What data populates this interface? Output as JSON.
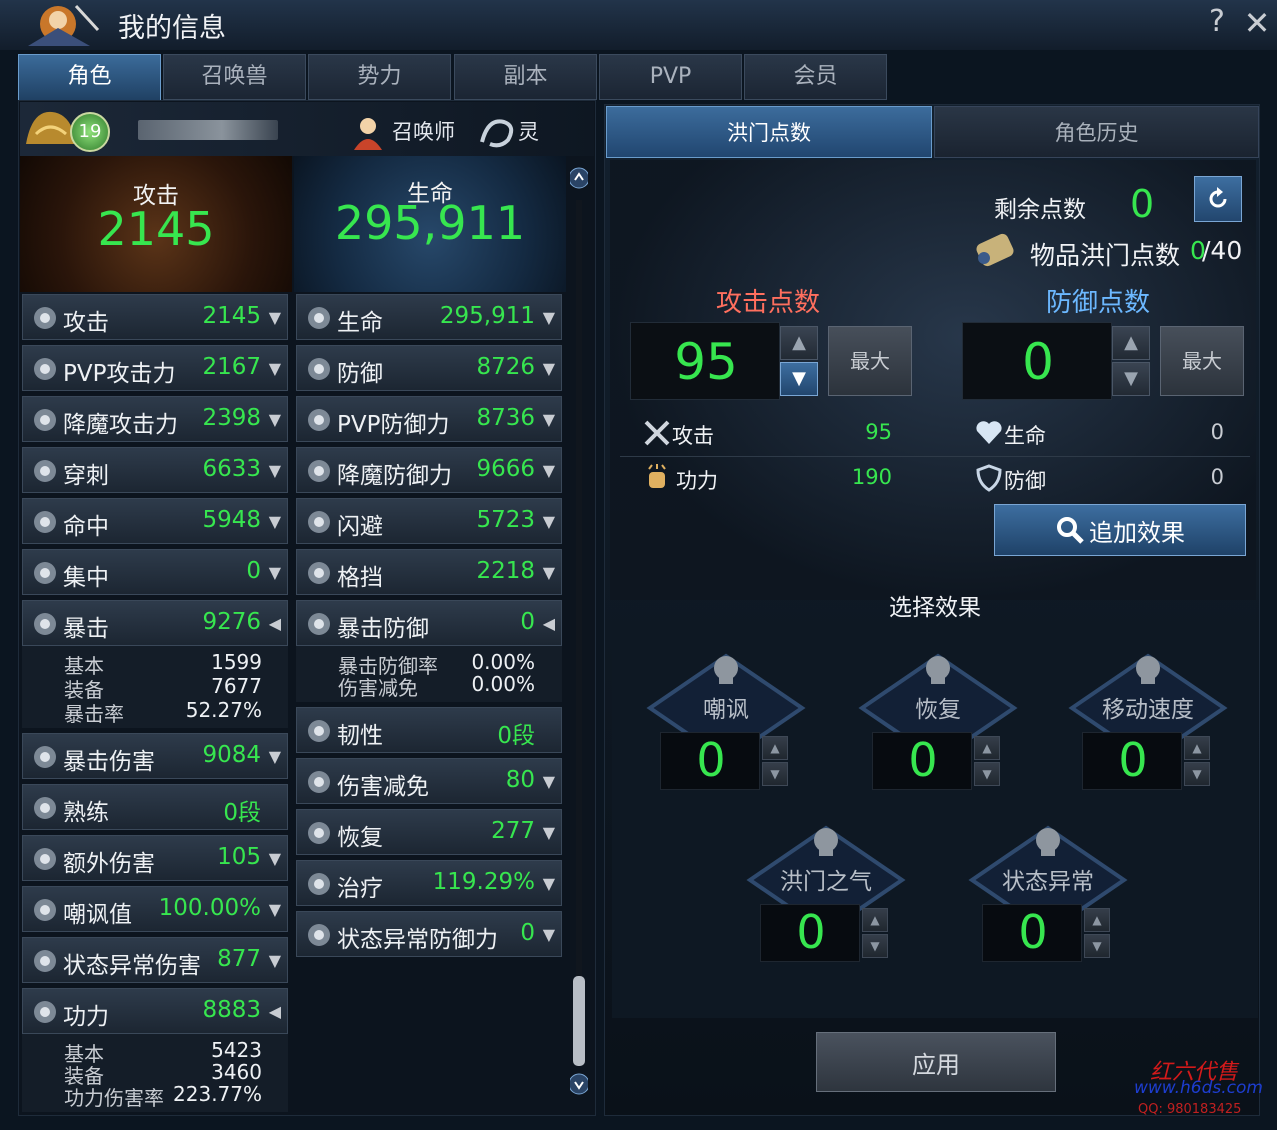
{
  "window": {
    "title": "我的信息",
    "help_label": "?",
    "close_label": "✕"
  },
  "tabs": [
    {
      "label": "角色",
      "active": true
    },
    {
      "label": "召唤兽",
      "active": false
    },
    {
      "label": "势力",
      "active": false
    },
    {
      "label": "副本",
      "active": false
    },
    {
      "label": "PVP",
      "active": false
    },
    {
      "label": "会员",
      "active": false
    }
  ],
  "character": {
    "level": "19",
    "summoner_label": "召唤师",
    "spirit_label": "灵"
  },
  "hero": {
    "attack_label": "攻击",
    "attack_value": "2145",
    "hp_label": "生命",
    "hp_value": "295,911"
  },
  "left_stats": [
    {
      "name": "攻击",
      "value": "2145",
      "icon": "sword-icon"
    },
    {
      "name": "PVP攻击力",
      "value": "2167",
      "icon": "pvp-attack-icon"
    },
    {
      "name": "降魔攻击力",
      "value": "2398",
      "icon": "demon-attack-icon"
    },
    {
      "name": "穿刺",
      "value": "6633",
      "icon": "pierce-icon"
    },
    {
      "name": "命中",
      "value": "5948",
      "icon": "crosshair-icon"
    },
    {
      "name": "集中",
      "value": "0",
      "icon": "focus-icon"
    },
    {
      "name": "暴击",
      "value": "9276",
      "icon": "critical-icon"
    },
    {
      "name": "暴击伤害",
      "value": "9084",
      "icon": "critical-damage-icon"
    },
    {
      "name": "熟练",
      "value": "0段",
      "icon": "mastery-icon"
    },
    {
      "name": "额外伤害",
      "value": "105",
      "icon": "extra-damage-icon"
    },
    {
      "name": "嘲讽值",
      "value": "100.00%",
      "icon": "taunt-icon"
    },
    {
      "name": "状态异常伤害",
      "value": "877",
      "icon": "status-damage-icon"
    },
    {
      "name": "功力",
      "value": "8883",
      "icon": "power-icon"
    }
  ],
  "crit_details": [
    {
      "label": "基本",
      "value": "1599"
    },
    {
      "label": "装备",
      "value": "7677"
    },
    {
      "label": "暴击率",
      "value": "52.27%"
    }
  ],
  "power_details": [
    {
      "label": "基本",
      "value": "5423"
    },
    {
      "label": "装备",
      "value": "3460"
    },
    {
      "label": "功力伤害率",
      "value": "223.77%"
    }
  ],
  "right_stats": [
    {
      "name": "生命",
      "value": "295,911",
      "icon": "heart-icon"
    },
    {
      "name": "防御",
      "value": "8726",
      "icon": "shield-icon"
    },
    {
      "name": "PVP防御力",
      "value": "8736",
      "icon": "pvp-defense-icon"
    },
    {
      "name": "降魔防御力",
      "value": "9666",
      "icon": "demon-defense-icon"
    },
    {
      "name": "闪避",
      "value": "5723",
      "icon": "evade-icon"
    },
    {
      "name": "格挡",
      "value": "2218",
      "icon": "block-icon"
    },
    {
      "name": "暴击防御",
      "value": "0",
      "icon": "crit-defense-icon"
    },
    {
      "name": "韧性",
      "value": "0段",
      "icon": "tenacity-icon"
    },
    {
      "name": "伤害减免",
      "value": "80",
      "icon": "damage-reduction-icon"
    },
    {
      "name": "恢复",
      "value": "277",
      "icon": "recovery-icon"
    },
    {
      "name": "治疗",
      "value": "119.29%",
      "icon": "heal-icon"
    },
    {
      "name": "状态异常防御力",
      "value": "0",
      "icon": "status-defense-icon"
    }
  ],
  "crit_defense_details": [
    {
      "label": "暴击防御率",
      "value": "0.00%"
    },
    {
      "label": "伤害减免",
      "value": "0.00%"
    }
  ],
  "right_tabs": {
    "hongmen": "洪门点数",
    "history": "角色历史"
  },
  "hongmen": {
    "remaining_label": "剩余点数",
    "remaining_value": "0",
    "item_label": "物品洪门点数",
    "item_value": "0",
    "item_max": "/40",
    "attack_points_label": "攻击点数",
    "defense_points_label": "防御点数",
    "attack_points": "95",
    "defense_points": "0",
    "max_label": "最大",
    "attack_bonuses": [
      {
        "name": "攻击",
        "value": "95"
      },
      {
        "name": "功力",
        "value": "190"
      }
    ],
    "defense_bonuses": [
      {
        "name": "生命",
        "value": "0"
      },
      {
        "name": "防御",
        "value": "0"
      }
    ],
    "add_effect_label": "追加效果",
    "select_title": "选择效果",
    "effects": [
      {
        "name": "嘲讽",
        "value": "0",
        "icon": "skull-icon"
      },
      {
        "name": "恢复",
        "value": "0",
        "icon": "sprout-icon"
      },
      {
        "name": "移动速度",
        "value": "0",
        "icon": "running-icon"
      },
      {
        "name": "洪门之气",
        "value": "0",
        "icon": "dragon-icon"
      },
      {
        "name": "状态异常",
        "value": "0",
        "icon": "stars-icon"
      }
    ],
    "apply_label": "应用"
  },
  "watermark": {
    "name": "红六代售",
    "site": "www.h6ds.com",
    "qq": "QQ: 980183425"
  },
  "colors": {
    "value_green": "#37e64f",
    "attack_red": "#ff6f5e",
    "defense_blue": "#6cb8ff",
    "active_tab": "#3b6b9a"
  }
}
